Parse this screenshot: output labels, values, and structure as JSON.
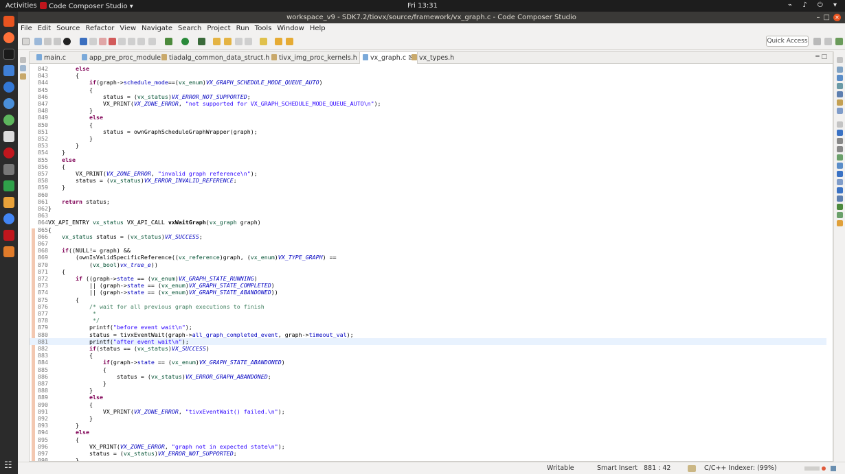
{
  "topbar": {
    "activities": "Activities",
    "app_name": "Code Composer Studio ▾",
    "clock": "Fri 13:31",
    "tray": "⌁ ♪ ⏻ ▾"
  },
  "window": {
    "title": "workspace_v9 - SDK7.2/tiovx/source/framework/vx_graph.c - Code Composer Studio"
  },
  "menu": [
    "File",
    "Edit",
    "Source",
    "Refactor",
    "View",
    "Navigate",
    "Search",
    "Project",
    "Run",
    "Tools",
    "Window",
    "Help"
  ],
  "quick_access": "Quick Access",
  "tabs": [
    {
      "label": "main.c",
      "kind": "c"
    },
    {
      "label": "app_pre_proc_module.c",
      "kind": "c"
    },
    {
      "label": "tiadalg_common_data_struct.h",
      "kind": "h"
    },
    {
      "label": "tivx_img_proc_kernels.h",
      "kind": "h"
    },
    {
      "label": "vx_graph.c ☒",
      "kind": "c",
      "active": true
    },
    {
      "label": "vx_types.h",
      "kind": "h"
    }
  ],
  "code_lines": [
    {
      "n": "842",
      "segs": [
        [
          "        ",
          ""
        ],
        [
          "else",
          "kw"
        ]
      ]
    },
    {
      "n": "843",
      "segs": [
        [
          "        {",
          ""
        ]
      ]
    },
    {
      "n": "844",
      "segs": [
        [
          "            ",
          ""
        ],
        [
          "if",
          "kw"
        ],
        [
          "(graph->",
          ""
        ],
        [
          "schedule_mode",
          "fld"
        ],
        [
          "==(",
          ""
        ],
        [
          "vx_enum",
          "ty"
        ],
        [
          ")",
          ""
        ],
        [
          "VX_GRAPH_SCHEDULE_MODE_QUEUE_AUTO",
          "mac"
        ],
        [
          ")",
          ""
        ]
      ]
    },
    {
      "n": "845",
      "segs": [
        [
          "            {",
          ""
        ]
      ]
    },
    {
      "n": "846",
      "segs": [
        [
          "                status = (",
          ""
        ],
        [
          "vx_status",
          "ty"
        ],
        [
          ")",
          ""
        ],
        [
          "VX_ERROR_NOT_SUPPORTED",
          "mac"
        ],
        [
          ";",
          ""
        ]
      ]
    },
    {
      "n": "847",
      "segs": [
        [
          "                VX_PRINT(",
          ""
        ],
        [
          "VX_ZONE_ERROR",
          "mac"
        ],
        [
          ", ",
          ""
        ],
        [
          "\"not supported for VX_GRAPH_SCHEDULE_MODE_QUEUE_AUTO\\n\"",
          "str"
        ],
        [
          ");",
          ""
        ]
      ]
    },
    {
      "n": "848",
      "segs": [
        [
          "            }",
          ""
        ]
      ]
    },
    {
      "n": "849",
      "segs": [
        [
          "            ",
          ""
        ],
        [
          "else",
          "kw"
        ]
      ]
    },
    {
      "n": "850",
      "segs": [
        [
          "            {",
          ""
        ]
      ]
    },
    {
      "n": "851",
      "segs": [
        [
          "                status = ownGraphScheduleGraphWrapper(graph);",
          ""
        ]
      ]
    },
    {
      "n": "852",
      "segs": [
        [
          "            }",
          ""
        ]
      ]
    },
    {
      "n": "853",
      "segs": [
        [
          "        }",
          ""
        ]
      ]
    },
    {
      "n": "854",
      "segs": [
        [
          "    }",
          ""
        ]
      ]
    },
    {
      "n": "855",
      "segs": [
        [
          "    ",
          ""
        ],
        [
          "else",
          "kw"
        ]
      ]
    },
    {
      "n": "856",
      "segs": [
        [
          "    {",
          ""
        ]
      ]
    },
    {
      "n": "857",
      "segs": [
        [
          "        VX_PRINT(",
          ""
        ],
        [
          "VX_ZONE_ERROR",
          "mac"
        ],
        [
          ", ",
          ""
        ],
        [
          "\"invalid graph reference\\n\"",
          "str"
        ],
        [
          ");",
          ""
        ]
      ]
    },
    {
      "n": "858",
      "segs": [
        [
          "        status = (",
          ""
        ],
        [
          "vx_status",
          "ty"
        ],
        [
          ")",
          ""
        ],
        [
          "VX_ERROR_INVALID_REFERENCE",
          "mac"
        ],
        [
          ";",
          ""
        ]
      ]
    },
    {
      "n": "859",
      "segs": [
        [
          "    }",
          ""
        ]
      ]
    },
    {
      "n": "860",
      "segs": [
        [
          "",
          ""
        ]
      ]
    },
    {
      "n": "861",
      "segs": [
        [
          "    ",
          ""
        ],
        [
          "return",
          "kw"
        ],
        [
          " status;",
          ""
        ]
      ]
    },
    {
      "n": "862",
      "segs": [
        [
          "}",
          ""
        ]
      ]
    },
    {
      "n": "863",
      "segs": [
        [
          "",
          ""
        ]
      ]
    },
    {
      "n": "864",
      "segs": [
        [
          "VX_API_ENTRY ",
          ""
        ],
        [
          "vx_status",
          "ty"
        ],
        [
          " VX_API_CALL ",
          ""
        ],
        [
          "vxWaitGraph",
          "fn"
        ],
        [
          "(",
          ""
        ],
        [
          "vx_graph",
          "ty"
        ],
        [
          " graph)",
          ""
        ]
      ]
    },
    {
      "n": "865",
      "segs": [
        [
          "{",
          ""
        ]
      ]
    },
    {
      "n": "866",
      "segs": [
        [
          "    ",
          ""
        ],
        [
          "vx_status",
          "ty"
        ],
        [
          " status = (",
          ""
        ],
        [
          "vx_status",
          "ty"
        ],
        [
          ")",
          ""
        ],
        [
          "VX_SUCCESS",
          "mac"
        ],
        [
          ";",
          ""
        ]
      ]
    },
    {
      "n": "867",
      "segs": [
        [
          "",
          ""
        ]
      ]
    },
    {
      "n": "868",
      "segs": [
        [
          "    ",
          ""
        ],
        [
          "if",
          "kw"
        ],
        [
          "((NULL!= graph) &&",
          ""
        ]
      ]
    },
    {
      "n": "869",
      "segs": [
        [
          "        (ownIsValidSpecificReference((",
          ""
        ],
        [
          "vx_reference",
          "ty"
        ],
        [
          ")graph, (",
          ""
        ],
        [
          "vx_enum",
          "ty"
        ],
        [
          ")",
          ""
        ],
        [
          "VX_TYPE_GRAPH",
          "mac"
        ],
        [
          ") ==",
          ""
        ]
      ]
    },
    {
      "n": "870",
      "segs": [
        [
          "            (",
          ""
        ],
        [
          "vx_bool",
          "ty"
        ],
        [
          ")",
          ""
        ],
        [
          "vx_true_e",
          "mac"
        ],
        [
          "))",
          ""
        ]
      ]
    },
    {
      "n": "871",
      "segs": [
        [
          "    {",
          ""
        ]
      ]
    },
    {
      "n": "872",
      "segs": [
        [
          "        ",
          ""
        ],
        [
          "if",
          "kw"
        ],
        [
          " ((graph->",
          ""
        ],
        [
          "state",
          "fld"
        ],
        [
          " == (",
          ""
        ],
        [
          "vx_enum",
          "ty"
        ],
        [
          ")",
          ""
        ],
        [
          "VX_GRAPH_STATE_RUNNING",
          "mac"
        ],
        [
          ")",
          ""
        ]
      ]
    },
    {
      "n": "873",
      "segs": [
        [
          "            || (graph->",
          ""
        ],
        [
          "state",
          "fld"
        ],
        [
          " == (",
          ""
        ],
        [
          "vx_enum",
          "ty"
        ],
        [
          ")",
          ""
        ],
        [
          "VX_GRAPH_STATE_COMPLETED",
          "mac"
        ],
        [
          ")",
          ""
        ]
      ]
    },
    {
      "n": "874",
      "segs": [
        [
          "            || (graph->",
          ""
        ],
        [
          "state",
          "fld"
        ],
        [
          " == (",
          ""
        ],
        [
          "vx_enum",
          "ty"
        ],
        [
          ")",
          ""
        ],
        [
          "VX_GRAPH_STATE_ABANDONED",
          "mac"
        ],
        [
          "))",
          ""
        ]
      ]
    },
    {
      "n": "875",
      "segs": [
        [
          "        {",
          ""
        ]
      ]
    },
    {
      "n": "876",
      "segs": [
        [
          "            ",
          ""
        ],
        [
          "/* wait for all previous graph executions to finish",
          "cmt"
        ]
      ]
    },
    {
      "n": "877",
      "segs": [
        [
          "             ",
          ""
        ],
        [
          "*",
          "cmt"
        ]
      ]
    },
    {
      "n": "878",
      "segs": [
        [
          "             ",
          ""
        ],
        [
          "*/",
          "cmt"
        ]
      ]
    },
    {
      "n": "879",
      "segs": [
        [
          "            printf(",
          ""
        ],
        [
          "\"before event wait\\n\"",
          "str"
        ],
        [
          ");",
          ""
        ]
      ]
    },
    {
      "n": "880",
      "segs": [
        [
          "            status = tivxEventWait(graph->",
          ""
        ],
        [
          "all_graph_completed_event",
          "fld"
        ],
        [
          ", graph->",
          ""
        ],
        [
          "timeout_val",
          "fld"
        ],
        [
          ");",
          ""
        ]
      ]
    },
    {
      "n": "881",
      "segs": [
        [
          "            printf(",
          ""
        ],
        [
          "\"after event wait\\n\"",
          "str"
        ],
        [
          ");",
          ""
        ]
      ],
      "current": true
    },
    {
      "n": "882",
      "segs": [
        [
          "            ",
          ""
        ],
        [
          "if",
          "kw"
        ],
        [
          "(status == (",
          ""
        ],
        [
          "vx_status",
          "ty"
        ],
        [
          ")",
          ""
        ],
        [
          "VX_SUCCESS",
          "mac"
        ],
        [
          ")",
          ""
        ]
      ]
    },
    {
      "n": "883",
      "segs": [
        [
          "            {",
          ""
        ]
      ]
    },
    {
      "n": "884",
      "segs": [
        [
          "                ",
          ""
        ],
        [
          "if",
          "kw"
        ],
        [
          "(graph->",
          ""
        ],
        [
          "state",
          "fld"
        ],
        [
          " == (",
          ""
        ],
        [
          "vx_enum",
          "ty"
        ],
        [
          ")",
          ""
        ],
        [
          "VX_GRAPH_STATE_ABANDONED",
          "mac"
        ],
        [
          ")",
          ""
        ]
      ]
    },
    {
      "n": "885",
      "segs": [
        [
          "                {",
          ""
        ]
      ]
    },
    {
      "n": "886",
      "segs": [
        [
          "                    status = (",
          ""
        ],
        [
          "vx_status",
          "ty"
        ],
        [
          ")",
          ""
        ],
        [
          "VX_ERROR_GRAPH_ABANDONED",
          "mac"
        ],
        [
          ";",
          ""
        ]
      ]
    },
    {
      "n": "887",
      "segs": [
        [
          "                }",
          ""
        ]
      ]
    },
    {
      "n": "888",
      "segs": [
        [
          "            }",
          ""
        ]
      ]
    },
    {
      "n": "889",
      "segs": [
        [
          "            ",
          ""
        ],
        [
          "else",
          "kw"
        ]
      ]
    },
    {
      "n": "890",
      "segs": [
        [
          "            {",
          ""
        ]
      ]
    },
    {
      "n": "891",
      "segs": [
        [
          "                VX_PRINT(",
          ""
        ],
        [
          "VX_ZONE_ERROR",
          "mac"
        ],
        [
          ", ",
          ""
        ],
        [
          "\"tivxEventWait() failed.\\n\"",
          "str"
        ],
        [
          ");",
          ""
        ]
      ]
    },
    {
      "n": "892",
      "segs": [
        [
          "            }",
          ""
        ]
      ]
    },
    {
      "n": "893",
      "segs": [
        [
          "        }",
          ""
        ]
      ]
    },
    {
      "n": "894",
      "segs": [
        [
          "        ",
          ""
        ],
        [
          "else",
          "kw"
        ]
      ]
    },
    {
      "n": "895",
      "segs": [
        [
          "        {",
          ""
        ]
      ]
    },
    {
      "n": "896",
      "segs": [
        [
          "            VX_PRINT(",
          ""
        ],
        [
          "VX_ZONE_ERROR",
          "mac"
        ],
        [
          ", ",
          ""
        ],
        [
          "\"graph not in expected state\\n\"",
          "str"
        ],
        [
          ");",
          ""
        ]
      ]
    },
    {
      "n": "897",
      "segs": [
        [
          "            status = (",
          ""
        ],
        [
          "vx_status",
          "ty"
        ],
        [
          ")",
          ""
        ],
        [
          "VX_ERROR_NOT_SUPPORTED",
          "mac"
        ],
        [
          ";",
          ""
        ]
      ]
    },
    {
      "n": "898",
      "segs": [
        [
          "        }",
          ""
        ]
      ]
    }
  ],
  "status": {
    "writable": "Writable",
    "insert_mode": "Smart Insert",
    "cursor": "881 : 42",
    "indexer": "C/C++ Indexer: (99%)"
  },
  "colors": {
    "accent": "#e95420",
    "ccs_red": "#c0161d"
  }
}
